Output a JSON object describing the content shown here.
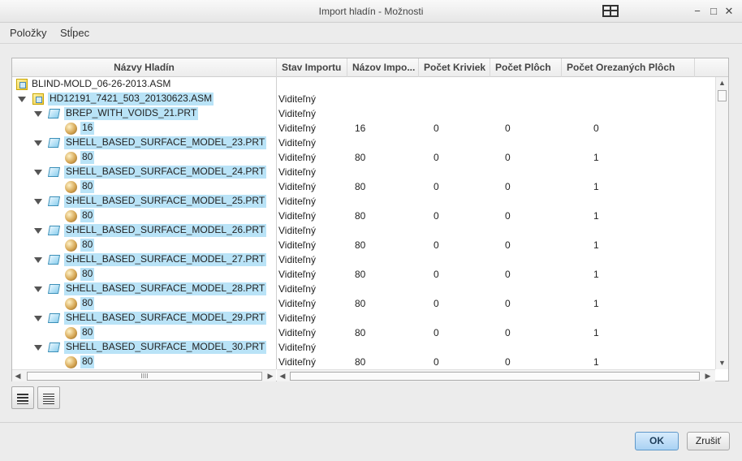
{
  "window": {
    "title": "Import hladín - Možnosti",
    "min_glyph": "−",
    "max_glyph": "□",
    "close_glyph": "✕"
  },
  "menu": {
    "items": [
      "Položky",
      "Stĺpec"
    ]
  },
  "table": {
    "columns": [
      "Názvy Hladín",
      "Stav Importu",
      "Názov Impo...",
      "Počet Kriviek",
      "Počet Plôch",
      "Počet Orezaných Plôch"
    ],
    "rows": [
      {
        "icon": "assembly-icon",
        "name": "BLIND-MOLD_06-26-2013.ASM",
        "status": "",
        "import": "",
        "curves": "",
        "surfaces": "",
        "trimmed": ""
      },
      {
        "icon": "assembly-icon",
        "name": "HD12191_7421_503_20130623.ASM",
        "status": "Viditeľný",
        "import": "",
        "curves": "",
        "surfaces": "",
        "trimmed": ""
      },
      {
        "icon": "part-icon",
        "name": "BREP_WITH_VOIDS_21.PRT",
        "status": "Viditeľný",
        "import": "",
        "curves": "",
        "surfaces": "",
        "trimmed": ""
      },
      {
        "icon": "layer-sphere-icon",
        "name": "16",
        "status": "Viditeľný",
        "import": "16",
        "curves": "0",
        "surfaces": "0",
        "trimmed": "0"
      },
      {
        "icon": "part-icon",
        "name": "SHELL_BASED_SURFACE_MODEL_23.PRT",
        "status": "Viditeľný",
        "import": "",
        "curves": "",
        "surfaces": "",
        "trimmed": ""
      },
      {
        "icon": "layer-sphere-icon",
        "name": "80",
        "status": "Viditeľný",
        "import": "80",
        "curves": "0",
        "surfaces": "0",
        "trimmed": "1"
      },
      {
        "icon": "part-icon",
        "name": "SHELL_BASED_SURFACE_MODEL_24.PRT",
        "status": "Viditeľný",
        "import": "",
        "curves": "",
        "surfaces": "",
        "trimmed": ""
      },
      {
        "icon": "layer-sphere-icon",
        "name": "80",
        "status": "Viditeľný",
        "import": "80",
        "curves": "0",
        "surfaces": "0",
        "trimmed": "1"
      },
      {
        "icon": "part-icon",
        "name": "SHELL_BASED_SURFACE_MODEL_25.PRT",
        "status": "Viditeľný",
        "import": "",
        "curves": "",
        "surfaces": "",
        "trimmed": ""
      },
      {
        "icon": "layer-sphere-icon",
        "name": "80",
        "status": "Viditeľný",
        "import": "80",
        "curves": "0",
        "surfaces": "0",
        "trimmed": "1"
      },
      {
        "icon": "part-icon",
        "name": "SHELL_BASED_SURFACE_MODEL_26.PRT",
        "status": "Viditeľný",
        "import": "",
        "curves": "",
        "surfaces": "",
        "trimmed": ""
      },
      {
        "icon": "layer-sphere-icon",
        "name": "80",
        "status": "Viditeľný",
        "import": "80",
        "curves": "0",
        "surfaces": "0",
        "trimmed": "1"
      },
      {
        "icon": "part-icon",
        "name": "SHELL_BASED_SURFACE_MODEL_27.PRT",
        "status": "Viditeľný",
        "import": "",
        "curves": "",
        "surfaces": "",
        "trimmed": ""
      },
      {
        "icon": "layer-sphere-icon",
        "name": "80",
        "status": "Viditeľný",
        "import": "80",
        "curves": "0",
        "surfaces": "0",
        "trimmed": "1"
      },
      {
        "icon": "part-icon",
        "name": "SHELL_BASED_SURFACE_MODEL_28.PRT",
        "status": "Viditeľný",
        "import": "",
        "curves": "",
        "surfaces": "",
        "trimmed": ""
      },
      {
        "icon": "layer-sphere-icon",
        "name": "80",
        "status": "Viditeľný",
        "import": "80",
        "curves": "0",
        "surfaces": "0",
        "trimmed": "1"
      },
      {
        "icon": "part-icon",
        "name": "SHELL_BASED_SURFACE_MODEL_29.PRT",
        "status": "Viditeľný",
        "import": "",
        "curves": "",
        "surfaces": "",
        "trimmed": ""
      },
      {
        "icon": "layer-sphere-icon",
        "name": "80",
        "status": "Viditeľný",
        "import": "80",
        "curves": "0",
        "surfaces": "0",
        "trimmed": "1"
      },
      {
        "icon": "part-icon",
        "name": "SHELL_BASED_SURFACE_MODEL_30.PRT",
        "status": "Viditeľný",
        "import": "",
        "curves": "",
        "surfaces": "",
        "trimmed": ""
      },
      {
        "icon": "layer-sphere-icon",
        "name": "80",
        "status": "Viditeľný",
        "import": "80",
        "curves": "0",
        "surfaces": "0",
        "trimmed": "1"
      }
    ]
  },
  "scrollbar": {
    "left_thumb_glyph": "IIII"
  },
  "buttons": {
    "ok": "OK",
    "cancel": "Zrušiť"
  },
  "colors": {
    "selection": "#b9e3f7",
    "ok_button": "#a9d1f3"
  }
}
